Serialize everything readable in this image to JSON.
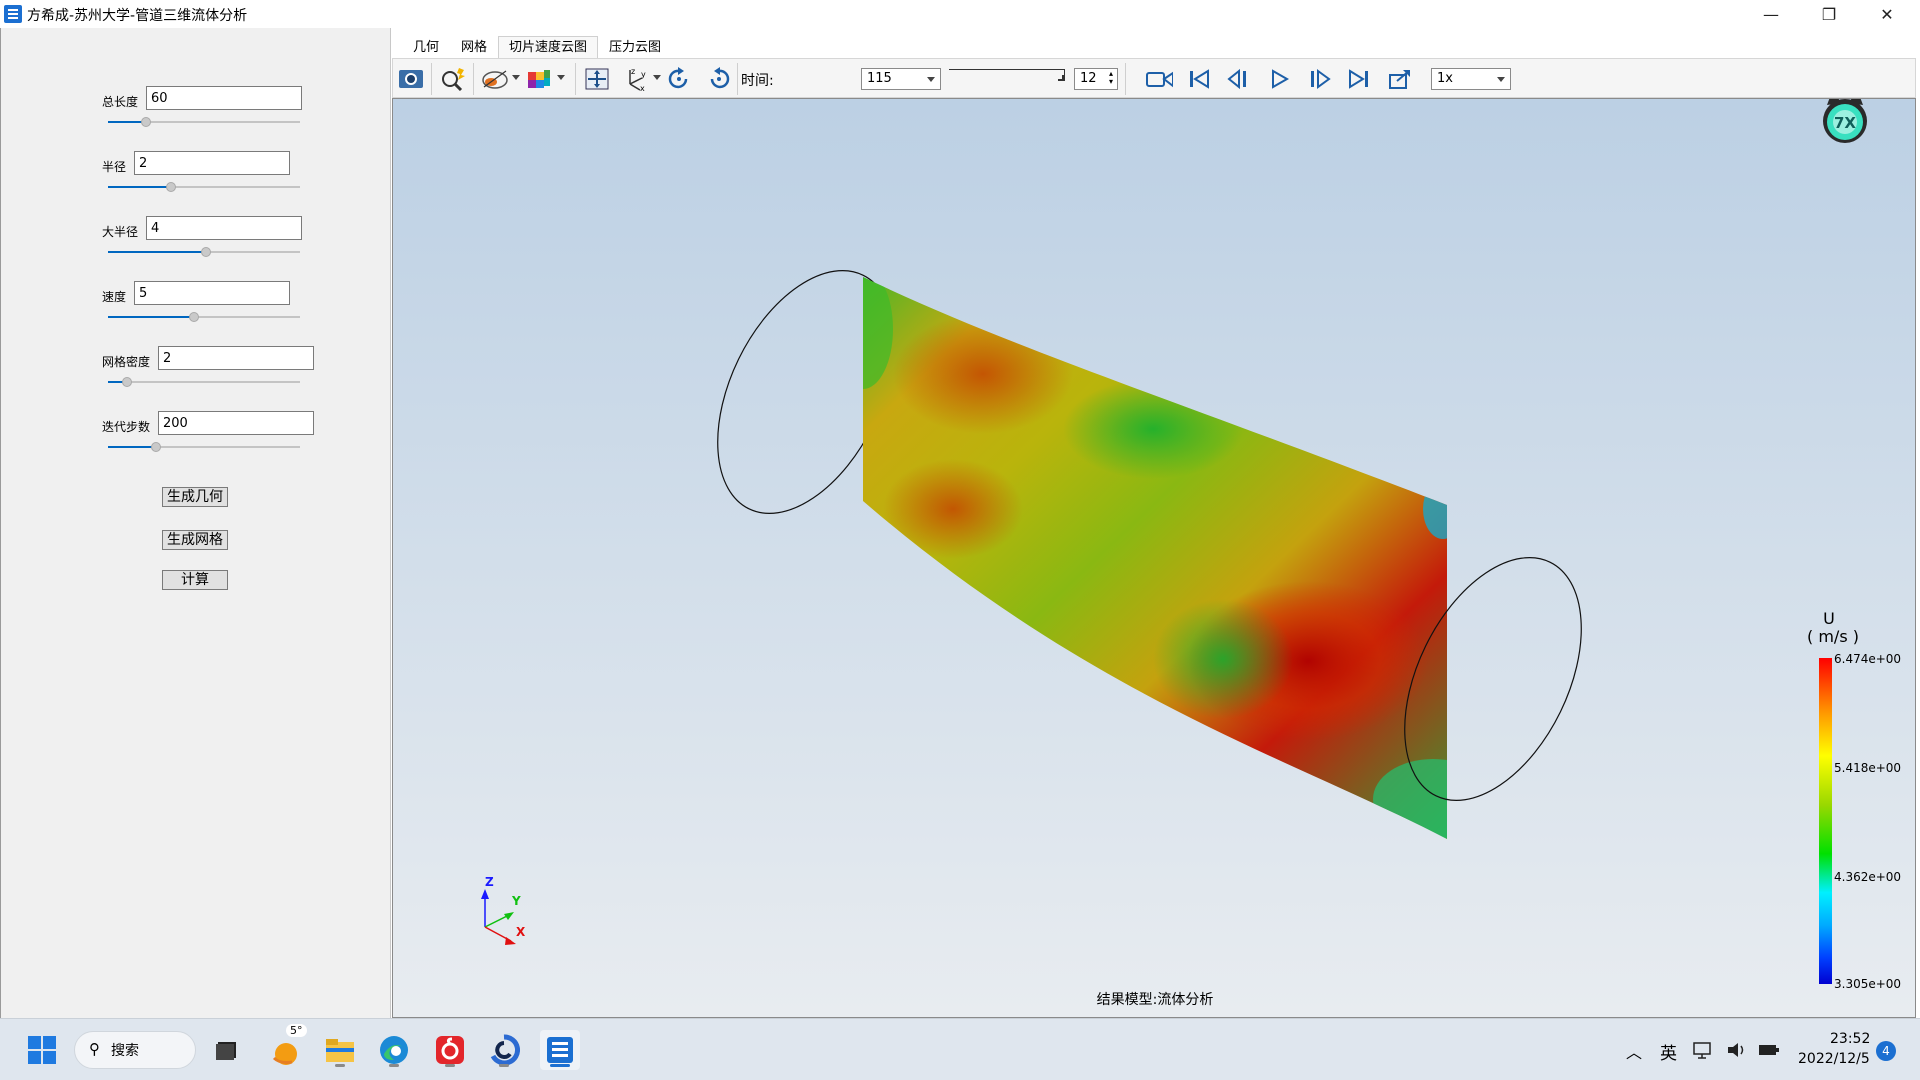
{
  "window": {
    "title": "方希成-苏州大学-管道三维流体分析",
    "minimize_glyph": "—",
    "maximize_glyph": "❐",
    "close_glyph": "✕"
  },
  "params": [
    {
      "label": "总长度",
      "value": "60",
      "slider_level": 0.2
    },
    {
      "label": "半径",
      "value": "2",
      "slider_level": 0.33
    },
    {
      "label": "大半径",
      "value": "4",
      "slider_level": 0.51
    },
    {
      "label": "速度",
      "value": "5",
      "slider_level": 0.45
    },
    {
      "label": "网格密度",
      "value": "2",
      "slider_level": 0.1
    },
    {
      "label": "迭代步数",
      "value": "200",
      "slider_level": 0.25
    }
  ],
  "buttons": {
    "generate_geometry": "生成几何",
    "generate_mesh": "生成网格",
    "compute": "计算"
  },
  "tabs": [
    "几何",
    "网格",
    "切片速度云图",
    "压力云图"
  ],
  "active_tab": "切片速度云图",
  "toolbar": {
    "time_label": "时间:",
    "time_value": "115",
    "frame_value": "12",
    "speed_value": "1x",
    "icons": [
      "camera-icon",
      "zoom-icon",
      "slice-icon",
      "colormap-icon",
      "fit-view-icon",
      "axes-icon",
      "rotate-cw-icon",
      "rotate-ccw-icon",
      "record-icon",
      "first-frame-icon",
      "prev-frame-icon",
      "play-icon",
      "next-frame-icon",
      "last-frame-icon",
      "export-icon"
    ]
  },
  "legend": {
    "title_line1": "U",
    "title_line2": "( m/s )",
    "ticks": [
      "6.474e+00",
      "5.418e+00",
      "4.362e+00",
      "3.305e+00"
    ],
    "colors": [
      "#ff0000",
      "#ffff00",
      "#00e000",
      "#00f0ff",
      "#0000d0"
    ]
  },
  "status": "结果模型:流体分析",
  "axes": {
    "z": "Z",
    "y": "Y",
    "x": "X"
  },
  "taskbar": {
    "search": "搜索",
    "weather": "5°",
    "ime": "英",
    "time": "23:52",
    "date": "2022/12/5",
    "notifications": "4"
  }
}
